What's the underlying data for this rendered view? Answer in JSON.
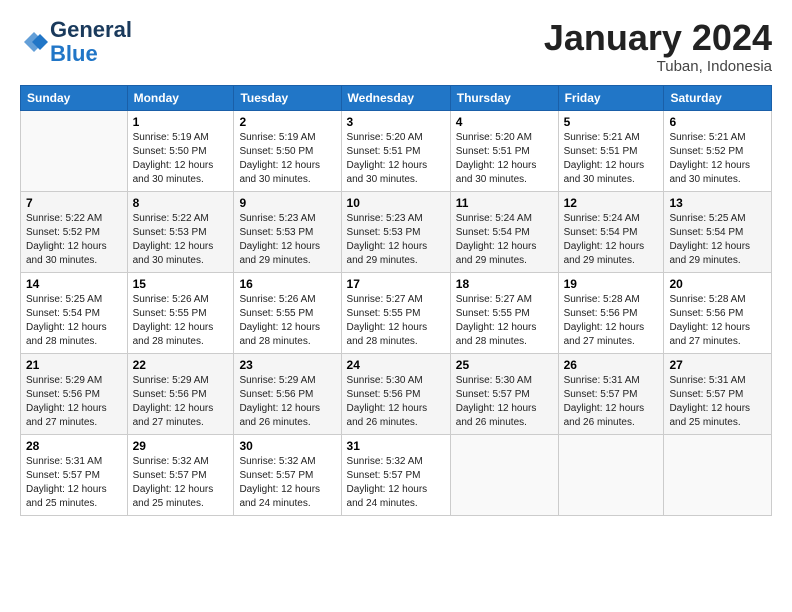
{
  "logo": {
    "line1": "General",
    "line2": "Blue"
  },
  "title": "January 2024",
  "subtitle": "Tuban, Indonesia",
  "days_of_week": [
    "Sunday",
    "Monday",
    "Tuesday",
    "Wednesday",
    "Thursday",
    "Friday",
    "Saturday"
  ],
  "weeks": [
    [
      {
        "day": "",
        "info": ""
      },
      {
        "day": "1",
        "info": "Sunrise: 5:19 AM\nSunset: 5:50 PM\nDaylight: 12 hours\nand 30 minutes."
      },
      {
        "day": "2",
        "info": "Sunrise: 5:19 AM\nSunset: 5:50 PM\nDaylight: 12 hours\nand 30 minutes."
      },
      {
        "day": "3",
        "info": "Sunrise: 5:20 AM\nSunset: 5:51 PM\nDaylight: 12 hours\nand 30 minutes."
      },
      {
        "day": "4",
        "info": "Sunrise: 5:20 AM\nSunset: 5:51 PM\nDaylight: 12 hours\nand 30 minutes."
      },
      {
        "day": "5",
        "info": "Sunrise: 5:21 AM\nSunset: 5:51 PM\nDaylight: 12 hours\nand 30 minutes."
      },
      {
        "day": "6",
        "info": "Sunrise: 5:21 AM\nSunset: 5:52 PM\nDaylight: 12 hours\nand 30 minutes."
      }
    ],
    [
      {
        "day": "7",
        "info": "Sunrise: 5:22 AM\nSunset: 5:52 PM\nDaylight: 12 hours\nand 30 minutes."
      },
      {
        "day": "8",
        "info": "Sunrise: 5:22 AM\nSunset: 5:53 PM\nDaylight: 12 hours\nand 30 minutes."
      },
      {
        "day": "9",
        "info": "Sunrise: 5:23 AM\nSunset: 5:53 PM\nDaylight: 12 hours\nand 29 minutes."
      },
      {
        "day": "10",
        "info": "Sunrise: 5:23 AM\nSunset: 5:53 PM\nDaylight: 12 hours\nand 29 minutes."
      },
      {
        "day": "11",
        "info": "Sunrise: 5:24 AM\nSunset: 5:54 PM\nDaylight: 12 hours\nand 29 minutes."
      },
      {
        "day": "12",
        "info": "Sunrise: 5:24 AM\nSunset: 5:54 PM\nDaylight: 12 hours\nand 29 minutes."
      },
      {
        "day": "13",
        "info": "Sunrise: 5:25 AM\nSunset: 5:54 PM\nDaylight: 12 hours\nand 29 minutes."
      }
    ],
    [
      {
        "day": "14",
        "info": "Sunrise: 5:25 AM\nSunset: 5:54 PM\nDaylight: 12 hours\nand 28 minutes."
      },
      {
        "day": "15",
        "info": "Sunrise: 5:26 AM\nSunset: 5:55 PM\nDaylight: 12 hours\nand 28 minutes."
      },
      {
        "day": "16",
        "info": "Sunrise: 5:26 AM\nSunset: 5:55 PM\nDaylight: 12 hours\nand 28 minutes."
      },
      {
        "day": "17",
        "info": "Sunrise: 5:27 AM\nSunset: 5:55 PM\nDaylight: 12 hours\nand 28 minutes."
      },
      {
        "day": "18",
        "info": "Sunrise: 5:27 AM\nSunset: 5:55 PM\nDaylight: 12 hours\nand 28 minutes."
      },
      {
        "day": "19",
        "info": "Sunrise: 5:28 AM\nSunset: 5:56 PM\nDaylight: 12 hours\nand 27 minutes."
      },
      {
        "day": "20",
        "info": "Sunrise: 5:28 AM\nSunset: 5:56 PM\nDaylight: 12 hours\nand 27 minutes."
      }
    ],
    [
      {
        "day": "21",
        "info": "Sunrise: 5:29 AM\nSunset: 5:56 PM\nDaylight: 12 hours\nand 27 minutes."
      },
      {
        "day": "22",
        "info": "Sunrise: 5:29 AM\nSunset: 5:56 PM\nDaylight: 12 hours\nand 27 minutes."
      },
      {
        "day": "23",
        "info": "Sunrise: 5:29 AM\nSunset: 5:56 PM\nDaylight: 12 hours\nand 26 minutes."
      },
      {
        "day": "24",
        "info": "Sunrise: 5:30 AM\nSunset: 5:56 PM\nDaylight: 12 hours\nand 26 minutes."
      },
      {
        "day": "25",
        "info": "Sunrise: 5:30 AM\nSunset: 5:57 PM\nDaylight: 12 hours\nand 26 minutes."
      },
      {
        "day": "26",
        "info": "Sunrise: 5:31 AM\nSunset: 5:57 PM\nDaylight: 12 hours\nand 26 minutes."
      },
      {
        "day": "27",
        "info": "Sunrise: 5:31 AM\nSunset: 5:57 PM\nDaylight: 12 hours\nand 25 minutes."
      }
    ],
    [
      {
        "day": "28",
        "info": "Sunrise: 5:31 AM\nSunset: 5:57 PM\nDaylight: 12 hours\nand 25 minutes."
      },
      {
        "day": "29",
        "info": "Sunrise: 5:32 AM\nSunset: 5:57 PM\nDaylight: 12 hours\nand 25 minutes."
      },
      {
        "day": "30",
        "info": "Sunrise: 5:32 AM\nSunset: 5:57 PM\nDaylight: 12 hours\nand 24 minutes."
      },
      {
        "day": "31",
        "info": "Sunrise: 5:32 AM\nSunset: 5:57 PM\nDaylight: 12 hours\nand 24 minutes."
      },
      {
        "day": "",
        "info": ""
      },
      {
        "day": "",
        "info": ""
      },
      {
        "day": "",
        "info": ""
      }
    ]
  ]
}
